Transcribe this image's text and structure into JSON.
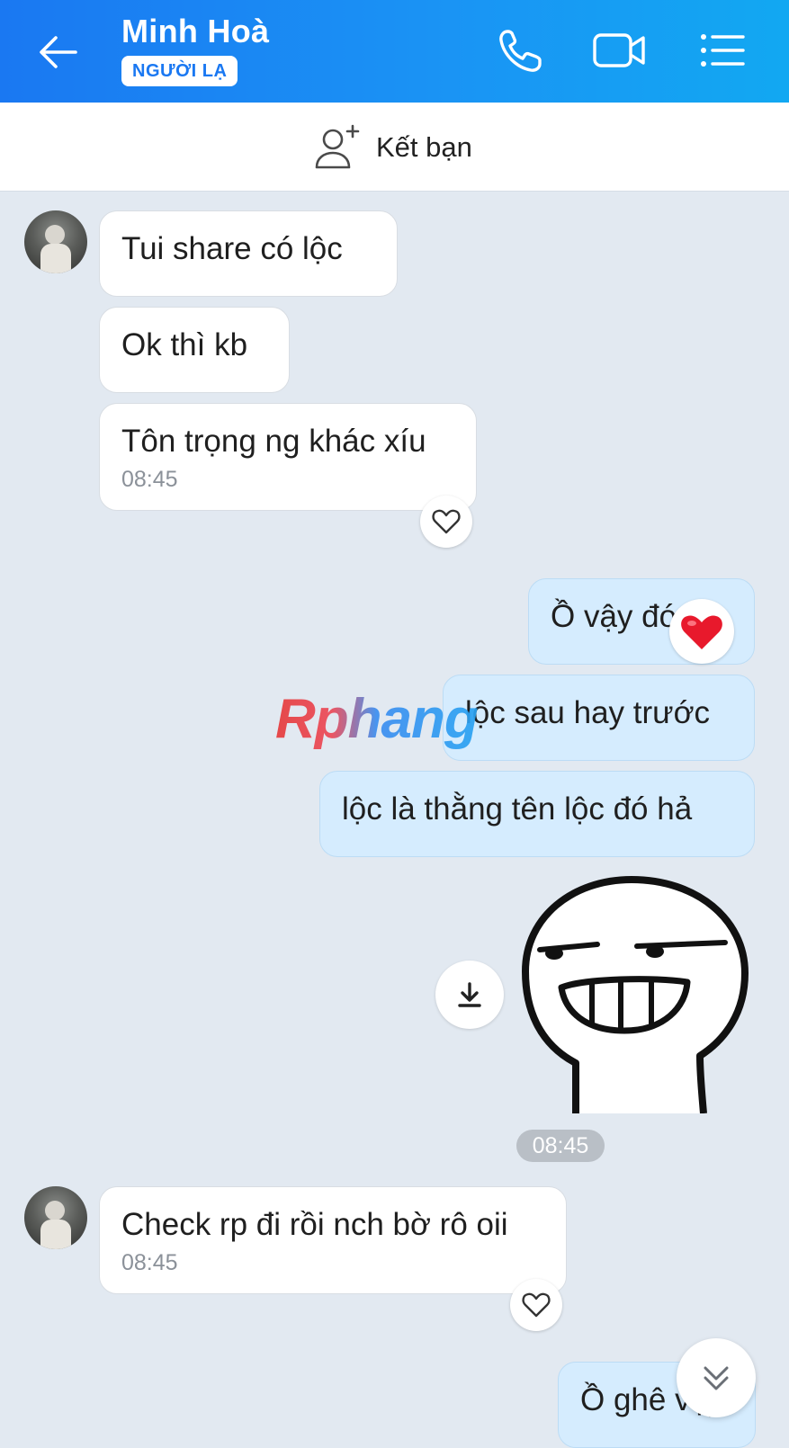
{
  "header": {
    "contact_name": "Minh Hoà",
    "badge": "NGƯỜI LẠ",
    "gradient_start": "#1a78f2",
    "gradient_end": "#12a8f2",
    "icons": [
      "arrow-left-icon",
      "phone-icon",
      "video-camera-icon",
      "list-menu-icon"
    ]
  },
  "add_friend": {
    "label": "Kết bạn",
    "icon": "add-person-icon"
  },
  "messages": [
    {
      "side": "in",
      "text": "Tui share có lộc"
    },
    {
      "side": "in",
      "text": "Ok thì kb"
    },
    {
      "side": "in",
      "text": "Tôn trọng ng khác xíu",
      "time": "08:45",
      "reaction": "heart-outline-icon"
    },
    {
      "side": "out",
      "text": "Ồ vậy đó hả",
      "reaction": "red-heart-icon"
    },
    {
      "side": "out",
      "text": "lộc sau hay trước"
    },
    {
      "side": "out",
      "text": "lộc là thằng tên lộc đó hả"
    },
    {
      "side": "out",
      "type": "sticker",
      "icon": "grinning-face-sticker"
    },
    {
      "type": "time_divider",
      "text": "08:45"
    },
    {
      "side": "in",
      "text": "Check rp đi rồi nch bờ rô oii",
      "time": "08:45",
      "reaction": "heart-outline-icon"
    },
    {
      "side": "out",
      "text": "Ồ ghê vậy"
    }
  ],
  "watermark": "Rphang",
  "colors": {
    "incoming_bubble": "#ffffff",
    "outgoing_bubble": "#d5ecfe",
    "chat_background": "#e2e9f1",
    "reaction_heart": "#e8192c"
  }
}
